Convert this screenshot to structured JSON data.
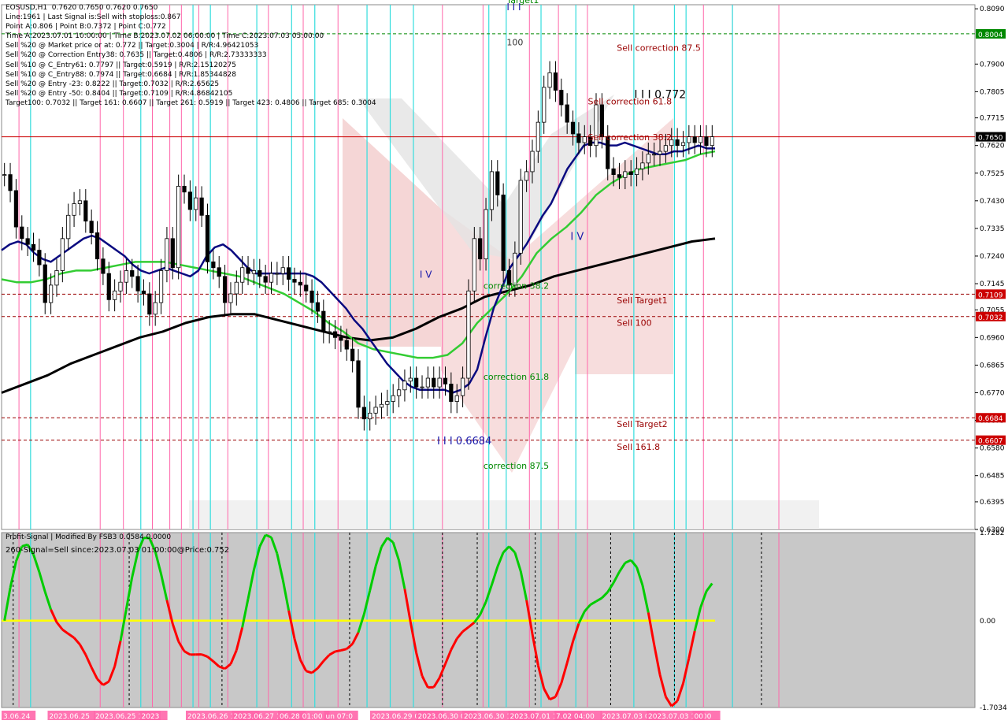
{
  "header": {
    "lines": [
      "EOSUSD,H1  0.7620 0.7650 0.7620 0.7650",
      "Line:1961 | Last Signal is:Sell with stoploss:0.867",
      "Point A:0.806 | Point B:0.7372 | Point C:0.772",
      "Time A:2023.07.01 10:00:00 | Time B:2023.07.02 06:00:00 | Time C:2023.07.03 05:00:00",
      "Sell %20 @ Market price or at: 0.772 || Target:0.3004 | R/R:4.96421053",
      "Sell %20 @ Correction Entry38: 0.7635 || Target:0.4806 | R/R:2.73333333",
      "Sell %10 @ C_Entry61: 0.7797 || Target:0.5919 | R/R:2.15120275",
      "Sell %10 @ C_Entry88: 0.7974 || Target:0.6684 | R/R:1.85344828",
      "Sell %20 @ Entry -23: 0.8222 || Target:0.7032 | R/R:2.65625",
      "Sell %20 @ Entry -50: 0.8404 || Target:0.7109 | R/R:4.86842105",
      "Target100: 0.7032 || Target 161: 0.6607 || Target 261: 0.5919 || Target 423: 0.4806 || Target 685: 0.3004"
    ]
  },
  "colors": {
    "background": "#ffffff",
    "candle": "#000000",
    "ma_fast": "#0a0a80",
    "ma_mid": "#33cc33",
    "ma_slow": "#000000",
    "signal_up": "#00cc00",
    "signal_down": "#ff0000",
    "zero_line": "#ffff00",
    "pink_vline": "#ff66aa",
    "cyan_vline": "#33dddd",
    "price_line": "#cc0000",
    "target_line": "#990000",
    "green_level": "#008800"
  },
  "chart_data": {
    "type": "candlestick",
    "symbol": "EOSUSD",
    "timeframe": "H1",
    "ylim": [
      0.63,
      0.8104
    ],
    "y_ticks": [
      "0.8090",
      "0.7900",
      "0.7805",
      "0.7715",
      "0.7620",
      "0.7525",
      "0.7430",
      "0.7335",
      "0.7240",
      "0.7145",
      "0.7055",
      "0.6960",
      "0.6865",
      "0.6770",
      "0.6675",
      "0.6580",
      "0.6485",
      "0.6395",
      "0.6300"
    ],
    "price_badges": [
      {
        "label": "0.8004",
        "value": 0.8004,
        "color": "#008800"
      },
      {
        "label": "0.7650",
        "value": 0.765,
        "color": "#000000"
      },
      {
        "label": "0.7109",
        "value": 0.7109,
        "color": "#cc0000"
      },
      {
        "label": "0.7032",
        "value": 0.7032,
        "color": "#cc0000"
      },
      {
        "label": "0.6684",
        "value": 0.6684,
        "color": "#cc0000"
      },
      {
        "label": "0.6607",
        "value": 0.6607,
        "color": "#cc0000"
      }
    ],
    "levels": [
      {
        "value": 0.8004,
        "color": "#008800",
        "style": "dashed"
      },
      {
        "value": 0.765,
        "color": "#cc0000",
        "style": "solid"
      },
      {
        "value": 0.7109,
        "color": "#990000",
        "style": "dashed"
      },
      {
        "value": 0.7032,
        "color": "#990000",
        "style": "dashed"
      },
      {
        "value": 0.6684,
        "color": "#990000",
        "style": "dashed"
      },
      {
        "value": 0.6607,
        "color": "#990000",
        "style": "dashed"
      }
    ],
    "annotations": [
      {
        "text": "Target1",
        "value": 0.811,
        "bar": 92,
        "color": "#008800",
        "size": 11
      },
      {
        "text": "I I I",
        "value": 0.8085,
        "bar": 92,
        "color": "#1a1aaa",
        "size": 12
      },
      {
        "text": "100",
        "value": 0.7965,
        "bar": 92,
        "color": "#333333",
        "size": 11
      },
      {
        "text": "Sell correction 87.5",
        "value": 0.7946,
        "bar": 111,
        "color": "#990000",
        "size": 11
      },
      {
        "text": "I I I 0.772",
        "value": 0.7783,
        "bar": 114,
        "color": "#000000",
        "size": 14
      },
      {
        "text": "Sell correction 61.8",
        "value": 0.7762,
        "bar": 106,
        "color": "#990000",
        "size": 11
      },
      {
        "text": "Sell correction 38.2",
        "value": 0.7638,
        "bar": 106,
        "color": "#990000",
        "size": 11
      },
      {
        "text": "I V",
        "value": 0.7295,
        "bar": 103,
        "color": "#1a1aaa",
        "size": 13
      },
      {
        "text": "correction 38.2",
        "value": 0.7127,
        "bar": 88,
        "color": "#008800",
        "size": 11
      },
      {
        "text": "Sell Target1",
        "value": 0.7077,
        "bar": 111,
        "color": "#990000",
        "size": 11
      },
      {
        "text": "Sell 100",
        "value": 0.7,
        "bar": 111,
        "color": "#990000",
        "size": 11
      },
      {
        "text": "correction 61.8",
        "value": 0.6815,
        "bar": 88,
        "color": "#008800",
        "size": 11
      },
      {
        "text": "I I I 0.6684",
        "value": 0.6593,
        "bar": 80,
        "color": "#1a1aaa",
        "size": 13
      },
      {
        "text": "Sell Target2",
        "value": 0.6652,
        "bar": 111,
        "color": "#990000",
        "size": 11
      },
      {
        "text": "Sell 161.8",
        "value": 0.6574,
        "bar": 111,
        "color": "#990000",
        "size": 11
      },
      {
        "text": "correction 87.5",
        "value": 0.6508,
        "bar": 88,
        "color": "#008800",
        "size": 11
      },
      {
        "text": "I V",
        "value": 0.7165,
        "bar": 77,
        "color": "#1a1aaa",
        "size": 12
      }
    ],
    "x_labels": [
      "3.06.24",
      "2023.06.25",
      "2023.06.25 14:00",
      "2023",
      "2023.06.26 15:00",
      "2023.06.27 12:00",
      "06.28 01:00",
      "un 07:0",
      "2023.06.29 04:00",
      "2023.06.30 00",
      "2023.06.30 17:00",
      "2023.07.01 16:00",
      "7.02 04:00",
      "2023.07.03 04",
      "2023.07.03 15:00",
      "00"
    ],
    "vlines_pink": [
      3,
      17,
      21,
      26,
      29,
      31,
      34,
      39,
      46,
      52,
      58,
      76,
      83,
      91,
      96,
      101,
      121,
      126,
      134
    ],
    "vlines_cyan": [
      5,
      24,
      33,
      36,
      44,
      50,
      54,
      63,
      67,
      71,
      84,
      87,
      93,
      99,
      109,
      116,
      118,
      126
    ],
    "vlines_dash": [
      2,
      22,
      38,
      60,
      76,
      82,
      92,
      105,
      116,
      131
    ],
    "sub_title": "Profit-Signal | Modified By FSB3 0.0584 0.0000",
    "sub_signal": "260-Signal=Sell since:2023.07.03 01:00:00@Price:0.752",
    "sub_ylim": [
      -1.7034,
      1.7282
    ],
    "sub_ticks": [
      "1.7282",
      "0.00",
      "-1.7034"
    ],
    "ohlc_close": [
      0.752,
      0.7465,
      0.734,
      0.73,
      0.728,
      0.726,
      0.721,
      0.708,
      0.714,
      0.719,
      0.73,
      0.738,
      0.742,
      0.743,
      0.736,
      0.732,
      0.723,
      0.718,
      0.709,
      0.712,
      0.715,
      0.719,
      0.717,
      0.712,
      0.711,
      0.704,
      0.708,
      0.719,
      0.73,
      0.72,
      0.748,
      0.746,
      0.74,
      0.744,
      0.738,
      0.722,
      0.72,
      0.717,
      0.708,
      0.711,
      0.715,
      0.72,
      0.718,
      0.719,
      0.717,
      0.715,
      0.718,
      0.718,
      0.72,
      0.716,
      0.715,
      0.714,
      0.712,
      0.708,
      0.705,
      0.698,
      0.698,
      0.696,
      0.695,
      0.692,
      0.688,
      0.672,
      0.668,
      0.67,
      0.672,
      0.673,
      0.674,
      0.676,
      0.678,
      0.681,
      0.682,
      0.679,
      0.679,
      0.682,
      0.679,
      0.682,
      0.68,
      0.674,
      0.676,
      0.682,
      0.712,
      0.73,
      0.723,
      0.74,
      0.753,
      0.745,
      0.719,
      0.714,
      0.725,
      0.75,
      0.753,
      0.76,
      0.77,
      0.782,
      0.787,
      0.781,
      0.776,
      0.77,
      0.766,
      0.763,
      0.765,
      0.762,
      0.776,
      0.765,
      0.754,
      0.752,
      0.751,
      0.753,
      0.752,
      0.754,
      0.756,
      0.759,
      0.759,
      0.76,
      0.762,
      0.764,
      0.762,
      0.763,
      0.765,
      0.763,
      0.765,
      0.762,
      0.765
    ],
    "ma_fast": [
      0.726,
      0.728,
      0.729,
      0.728,
      0.725,
      0.723,
      0.722,
      0.724,
      0.726,
      0.728,
      0.73,
      0.731,
      0.73,
      0.728,
      0.726,
      0.724,
      0.721,
      0.719,
      0.718,
      0.719,
      0.72,
      0.719,
      0.718,
      0.717,
      0.719,
      0.724,
      0.727,
      0.728,
      0.726,
      0.723,
      0.72,
      0.718,
      0.718,
      0.718,
      0.718,
      0.718,
      0.718,
      0.718,
      0.717,
      0.715,
      0.712,
      0.709,
      0.706,
      0.702,
      0.699,
      0.695,
      0.691,
      0.687,
      0.684,
      0.681,
      0.679,
      0.678,
      0.678,
      0.678,
      0.678,
      0.677,
      0.678,
      0.68,
      0.685,
      0.696,
      0.706,
      0.713,
      0.72,
      0.724,
      0.728,
      0.733,
      0.738,
      0.742,
      0.748,
      0.754,
      0.758,
      0.762,
      0.763,
      0.763,
      0.762,
      0.762,
      0.763,
      0.762,
      0.761,
      0.76,
      0.759,
      0.759,
      0.76,
      0.76,
      0.761,
      0.762,
      0.761,
      0.761
    ],
    "ma_mid": [
      0.716,
      0.715,
      0.715,
      0.716,
      0.718,
      0.719,
      0.719,
      0.72,
      0.721,
      0.722,
      0.722,
      0.722,
      0.721,
      0.72,
      0.719,
      0.718,
      0.717,
      0.715,
      0.713,
      0.711,
      0.708,
      0.705,
      0.701,
      0.698,
      0.694,
      0.692,
      0.691,
      0.69,
      0.689,
      0.689,
      0.69,
      0.694,
      0.701,
      0.706,
      0.711,
      0.717,
      0.725,
      0.73,
      0.734,
      0.739,
      0.745,
      0.749,
      0.752,
      0.754,
      0.755,
      0.756,
      0.757,
      0.759,
      0.76
    ],
    "ma_slow": [
      0.677,
      0.68,
      0.683,
      0.687,
      0.69,
      0.693,
      0.696,
      0.698,
      0.701,
      0.703,
      0.704,
      0.704,
      0.702,
      0.7,
      0.698,
      0.696,
      0.695,
      0.696,
      0.699,
      0.703,
      0.706,
      0.71,
      0.712,
      0.714,
      0.717,
      0.719,
      0.721,
      0.723,
      0.725,
      0.727,
      0.729,
      0.73
    ]
  }
}
